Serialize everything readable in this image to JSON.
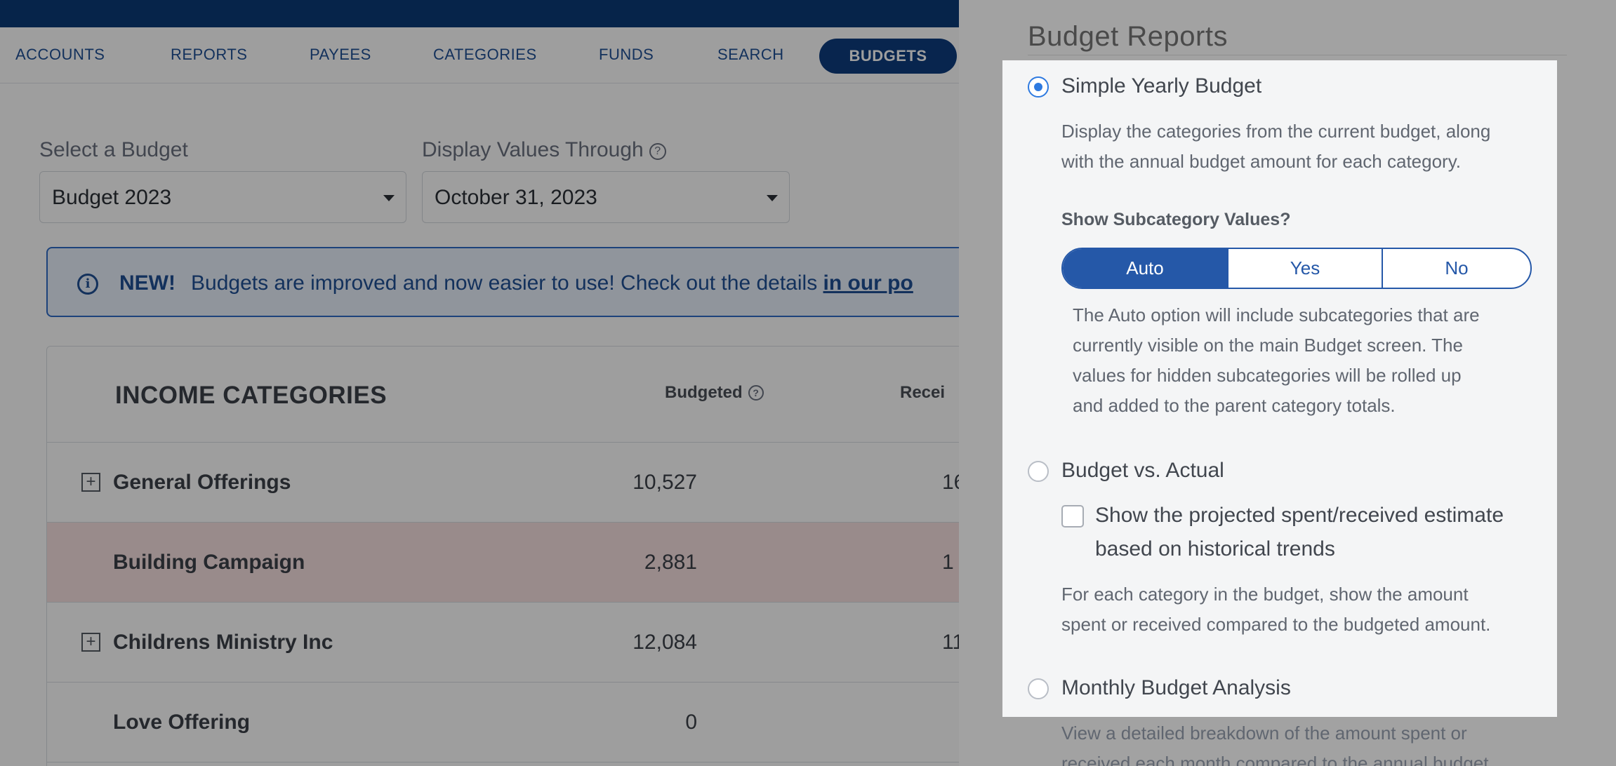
{
  "nav": {
    "items": [
      "ACCOUNTS",
      "REPORTS",
      "PAYEES",
      "CATEGORIES",
      "FUNDS",
      "SEARCH"
    ],
    "active": "BUDGETS"
  },
  "filters": {
    "budget_label": "Select a Budget",
    "budget_value": "Budget 2023",
    "through_label": "Display Values Through",
    "through_value": "October 31, 2023",
    "help_glyph": "?"
  },
  "notice": {
    "icon": "info-icon",
    "new": "NEW!",
    "text": "Budgets are improved and now easier to use! Check out the details ",
    "link": "in our po"
  },
  "table": {
    "title": "INCOME CATEGORIES",
    "col_budgeted": "Budgeted",
    "col_received": "Recei",
    "rows": [
      {
        "name": "General Offerings",
        "budgeted": "10,527",
        "received": "16",
        "expandable": true
      },
      {
        "name": "Building Campaign",
        "budgeted": "2,881",
        "received": "1",
        "expandable": false
      },
      {
        "name": "Childrens Ministry Inc",
        "budgeted": "12,084",
        "received": "11",
        "expandable": true
      },
      {
        "name": "Love Offering",
        "budgeted": "0",
        "received": "",
        "expandable": false
      }
    ]
  },
  "panel": {
    "title": "Budget Reports",
    "options": [
      {
        "title": "Simple Yearly Budget",
        "selected": true,
        "desc": [
          "Display the categories from the current budget, along",
          "with the annual budget amount for each category."
        ]
      },
      {
        "title": "Budget vs. Actual",
        "selected": false,
        "checkbox_label": [
          "Show the projected spent/received estimate",
          "based on historical trends"
        ],
        "desc": [
          "For each category in the budget, show the amount",
          "spent or received compared to the budgeted amount."
        ]
      },
      {
        "title": "Monthly Budget Analysis",
        "selected": false,
        "desc": [
          "View a detailed breakdown of the amount spent or",
          "received each month compared to the annual budget"
        ]
      }
    ],
    "subcategory": {
      "heading": "Show Subcategory Values?",
      "buttons": [
        "Auto",
        "Yes",
        "No"
      ],
      "selected": "Auto",
      "note": [
        "The Auto option will include subcategories that are",
        "currently visible on the main Budget screen. The",
        "values for hidden subcategories will be rolled up",
        "and added to the parent category totals."
      ]
    }
  },
  "colors": {
    "nav_dark": "#0a3a78",
    "accent_blue": "#2558a8",
    "radio_blue": "#2e7ae0",
    "highlight_row": "#f7e1e1",
    "panel_bg": "#a2a2a2"
  }
}
